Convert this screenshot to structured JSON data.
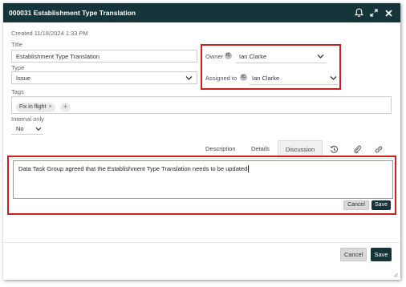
{
  "window": {
    "title": "000031 Establishment Type Translation",
    "icons": [
      "bell-icon",
      "expand-icon",
      "close-icon"
    ]
  },
  "meta": {
    "created": "Created 11/18/2024 1:33 PM"
  },
  "form": {
    "title_label": "Title",
    "title_value": "Establishment Type Translation",
    "type_label": "Type",
    "type_value": "Issue",
    "owner_label": "Owner",
    "owner_value": "Ian Clarke",
    "assigned_label": "Assigned to",
    "assigned_value": "Ian Clarke",
    "tags_label": "Tags",
    "tags": [
      "Fix in flight"
    ],
    "internal_label": "Internal only",
    "internal_value": "No"
  },
  "tabs": {
    "items": [
      "Description",
      "Details",
      "Discussion"
    ],
    "active": "Discussion",
    "icons": [
      "history-icon",
      "attachment-icon",
      "link-icon"
    ]
  },
  "discussion": {
    "text": "Data Task Group agreed that the Establishment Type Translation needs to be updated",
    "cancel_label": "Cancel",
    "save_label": "Save"
  },
  "footer": {
    "cancel_label": "Cancel",
    "save_label": "Save"
  },
  "colors": {
    "header_bg": "#16353a",
    "highlight": "#cc1f1f",
    "save_bg": "#16353a"
  }
}
